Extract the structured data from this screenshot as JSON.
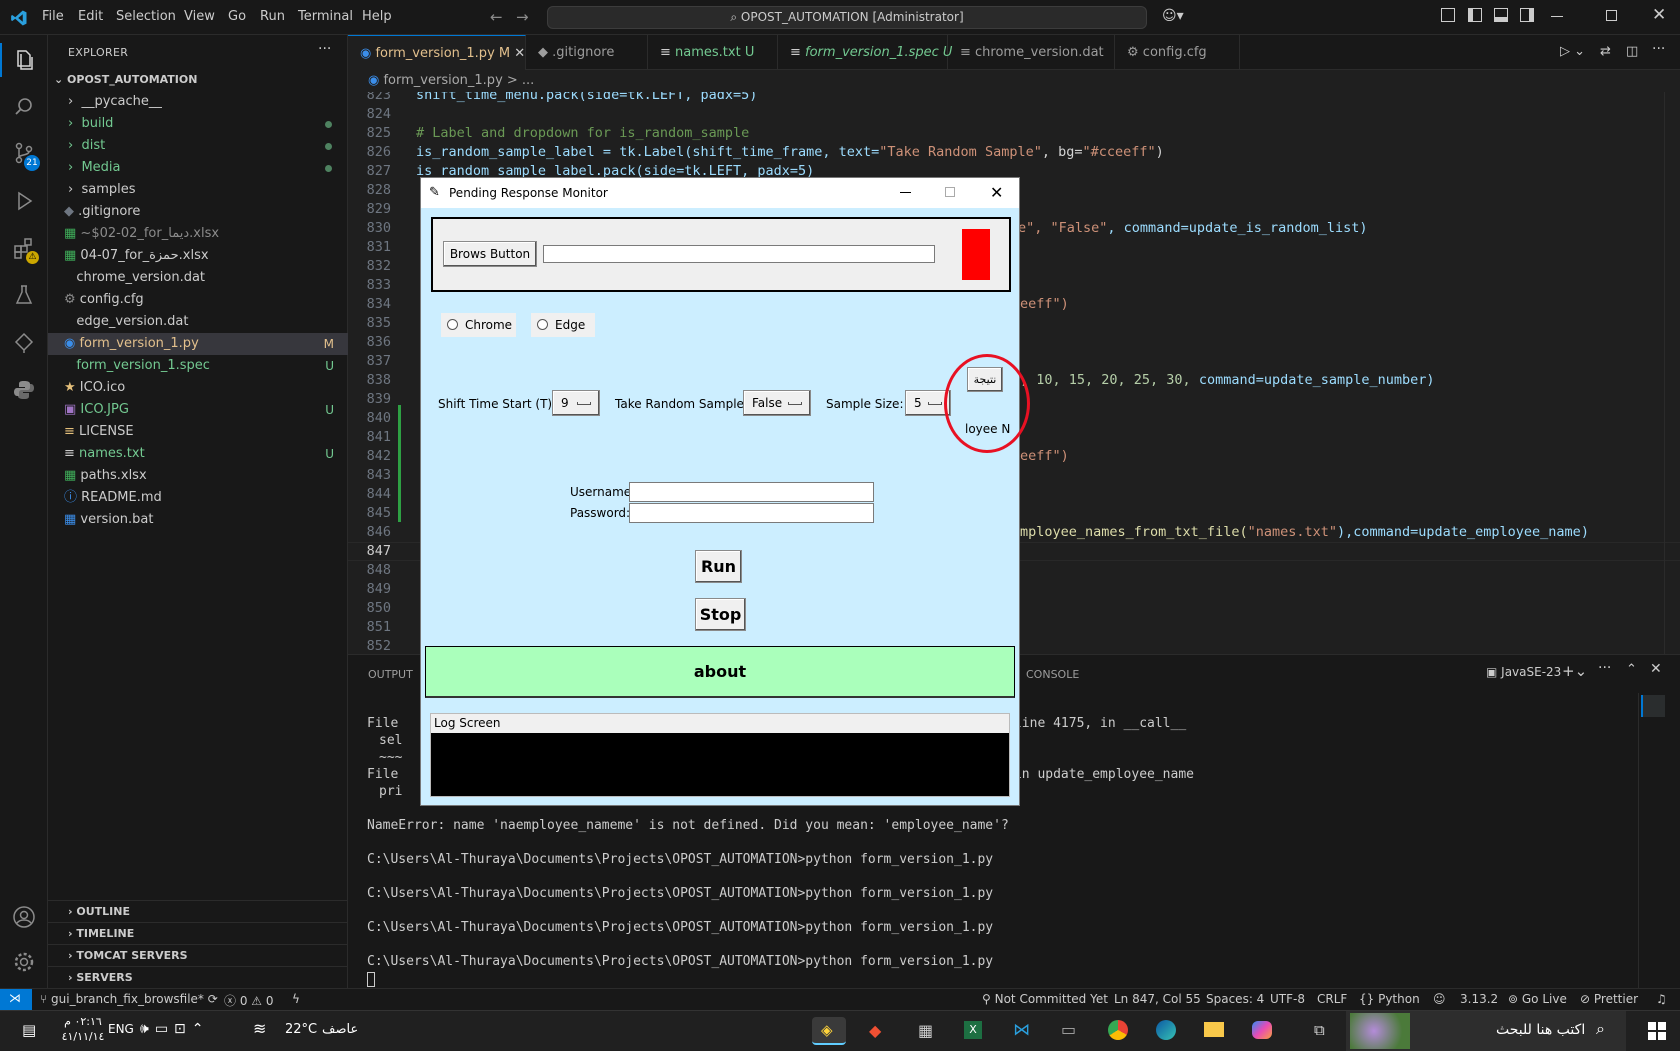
{
  "titlebar": {
    "menus": [
      "File",
      "Edit",
      "Selection",
      "View",
      "Go",
      "Run",
      "Terminal",
      "Help"
    ],
    "command_center": "OPOST_AUTOMATION [Administrator]"
  },
  "activity": {
    "scm_badge": "21"
  },
  "explorer": {
    "header": "EXPLORER",
    "root": "OPOST_AUTOMATION",
    "items": [
      {
        "label": "__pycache__",
        "git": ""
      },
      {
        "label": "build",
        "git": ""
      },
      {
        "label": "dist",
        "git": ""
      },
      {
        "label": "Media",
        "git": ""
      },
      {
        "label": "samples",
        "git": ""
      },
      {
        "label": ".gitignore",
        "git": ""
      },
      {
        "label": "~$02-02_for_ديما.xlsx",
        "git": ""
      },
      {
        "label": "04-07_for_حمزة.xlsx",
        "git": ""
      },
      {
        "label": "chrome_version.dat",
        "git": ""
      },
      {
        "label": "config.cfg",
        "git": ""
      },
      {
        "label": "edge_version.dat",
        "git": ""
      },
      {
        "label": "form_version_1.py",
        "git": "M"
      },
      {
        "label": "form_version_1.spec",
        "git": "U"
      },
      {
        "label": "ICO.ico",
        "git": ""
      },
      {
        "label": "ICO.JPG",
        "git": "U"
      },
      {
        "label": "LICENSE",
        "git": ""
      },
      {
        "label": "names.txt",
        "git": "U"
      },
      {
        "label": "paths.xlsx",
        "git": ""
      },
      {
        "label": "README.md",
        "git": ""
      },
      {
        "label": "version.bat",
        "git": ""
      }
    ],
    "sections": [
      "OUTLINE",
      "TIMELINE",
      "TOMCAT SERVERS",
      "SERVERS"
    ]
  },
  "tabs": [
    {
      "label": "form_version_1.py",
      "flag": "M"
    },
    {
      "label": ".gitignore",
      "flag": ""
    },
    {
      "label": "names.txt",
      "flag": "U"
    },
    {
      "label": "form_version_1.spec",
      "flag": "U"
    },
    {
      "label": "chrome_version.dat",
      "flag": ""
    },
    {
      "label": "config.cfg",
      "flag": ""
    }
  ],
  "breadcrumb": "form_version_1.py  >  ...",
  "editor": {
    "line_numbers": [
      "823",
      "824",
      "825",
      "826",
      "827",
      "828",
      "829",
      "830",
      "831",
      "832",
      "833",
      "834",
      "835",
      "836",
      "837",
      "838",
      "839",
      "840",
      "841",
      "842",
      "843",
      "844",
      "845",
      "846",
      "847",
      "848",
      "849",
      "850",
      "851",
      "852"
    ],
    "current_line": "847",
    "l823": "shift_time_menu.pack(side=tk.LEFT, padx=5)",
    "l825": "# Label and dropdown for is_random_sample",
    "l826a": "is_random_sample_label = tk.Label(shift_time_frame, text=",
    "l826b": "\"Take Random Sample\"",
    "l826c": ", bg=",
    "l826d": "\"#cceeff\"",
    "l826e": ")",
    "l827": "is_random_sample_label.pack(side=tk.LEFT, padx=5)",
    "r830a": "e\", ",
    "r830b": "\"False\"",
    "r830c": ", command=update_is_random_list)",
    "r834": "eeff\")",
    "r838a": ", 10, 15, 20, 25, 30, ",
    "r838b": "command=update_sample_number)",
    "r842": "eeff\")",
    "r846a": "mployee_names_from_txt_file(",
    "r846b": "\"names.txt\"",
    "r846c": "),command=update_employee_name)"
  },
  "panel": {
    "tabs": [
      "OUTPUT",
      "CONSOLE"
    ],
    "terminal_name": "JavaSE-23",
    "lines": {
      "t1a": "File ",
      "t1b": " line 4175, in __call__",
      "t2": "sel",
      "t3": "~~~",
      "t4a": "File ",
      "t4b": " in update_employee_name",
      "t5": "pri",
      "t6": "^^^^^^^^^^^^^^^^",
      "t7": "NameError: name 'naemployee_nameme' is not defined. Did you mean: 'employee_name'?",
      "t8": "C:\\Users\\Al-Thuraya\\Documents\\Projects\\OPOST_AUTOMATION>python form_version_1.py",
      "t9": "C:\\Users\\Al-Thuraya\\Documents\\Projects\\OPOST_AUTOMATION>python form_version_1.py",
      "t10": "C:\\Users\\Al-Thuraya\\Documents\\Projects\\OPOST_AUTOMATION>python form_version_1.py",
      "t11": "C:\\Users\\Al-Thuraya\\Documents\\Projects\\OPOST_AUTOMATION>python form_version_1.py"
    }
  },
  "statusbar": {
    "branch": "gui_branch_fix_browsfile*",
    "problems": "0",
    "warnings": "0",
    "not_committed": "Not Committed Yet",
    "position": "Ln 847, Col 55",
    "spaces": "Spaces: 4",
    "encoding": "UTF-8",
    "eol": "CRLF",
    "language": "Python",
    "version": "3.13.2",
    "golive": "Go Live",
    "prettier": "Prettier"
  },
  "taskbar": {
    "time": "٠٢:١٦ م",
    "date": "٤١/١١/١٤",
    "lang": "ENG",
    "temp": "22°C",
    "weather": "عاصف",
    "search": "اكتب هنا للبحث"
  },
  "tkwindow": {
    "title": "Pending Response Monitor",
    "browse_button": "Brows Button",
    "radios": [
      "Chrome",
      "Edge"
    ],
    "shift_label": "Shift Time Start (T):",
    "shift_value": "9",
    "random_label": "Take Random Sample",
    "random_value": "False",
    "sample_label": "Sample Size:",
    "sample_value": "5",
    "result_button": "نتيجة",
    "employee_label": "loyee N",
    "username_label": "Username:",
    "password_label": "Password:",
    "run": "Run",
    "stop": "Stop",
    "about": "about",
    "log_label": "Log Screen"
  },
  "colors": {
    "tk_bg": "#cceeff",
    "about_bg": "#aaffbb",
    "indicator": "#ff0000",
    "annotation_circle": "#e81123",
    "accent": "#0078d4"
  }
}
